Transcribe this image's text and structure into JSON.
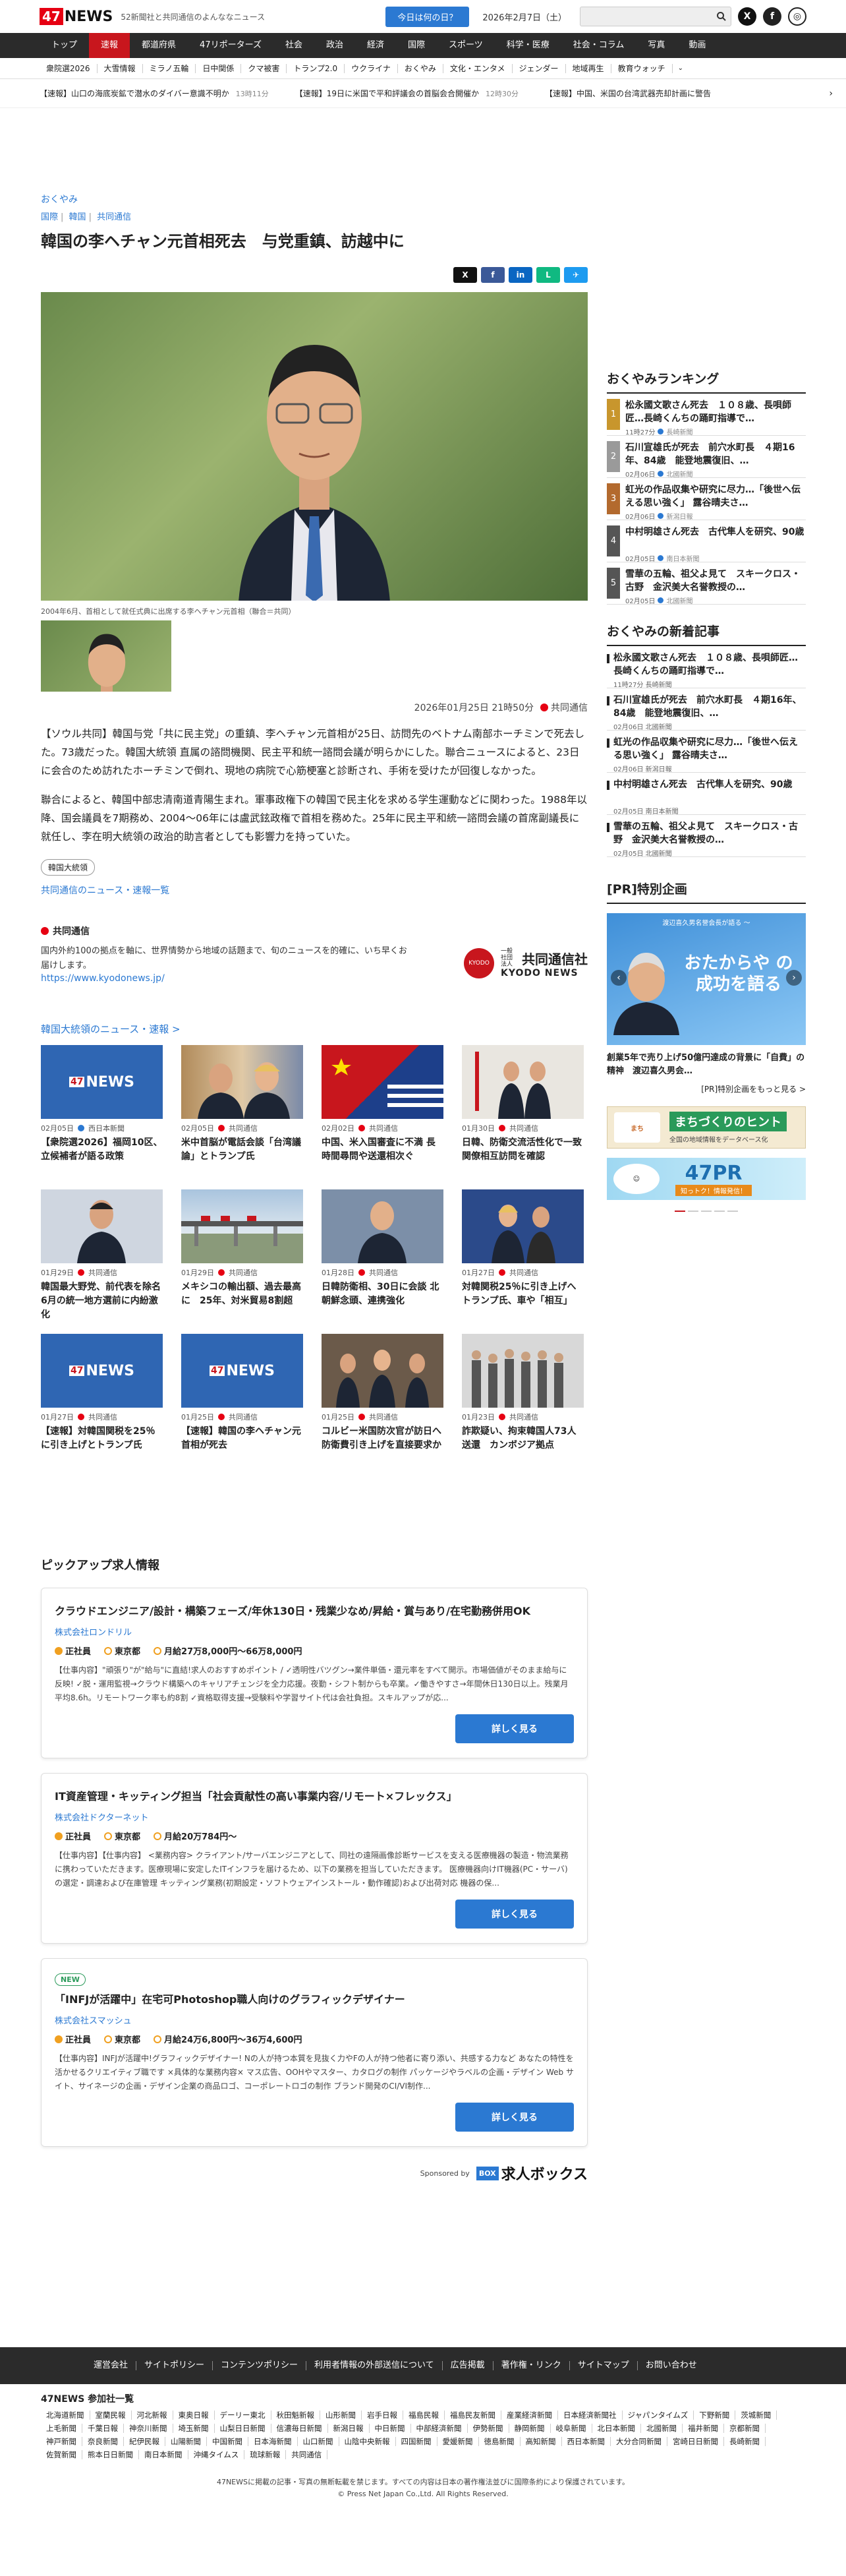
{
  "header": {
    "logo_text": "NEWS",
    "logo_num": "47",
    "tagline": "52新聞社と共同通信のよんななニュース",
    "today_button": "今日は何の日？",
    "date": "2026年2月7日（土）"
  },
  "nav": [
    "トップ",
    "速報",
    "都道府県",
    "47リポーターズ",
    "社会",
    "政治",
    "経済",
    "国際",
    "スポーツ",
    "科学・医療",
    "社会・コラム",
    "写真",
    "動画"
  ],
  "subnav": [
    "衆院選2026",
    "大雪情報",
    "ミラノ五輪",
    "日中関係",
    "クマ被害",
    "トランプ2.0",
    "ウクライナ",
    "おくやみ",
    "文化・エンタメ",
    "ジェンダー",
    "地域再生",
    "教育ウォッチ"
  ],
  "ticker": [
    {
      "text": "【速報】山口の海底炭鉱で潜水のダイバー意識不明か",
      "time": "13時11分"
    },
    {
      "text": "【速報】19日に米国で平和評議会の首脳会合開催か",
      "time": "12時30分"
    },
    {
      "text": "【速報】中国、米国の台湾武器売却計画に警告"
    }
  ],
  "article": {
    "kicker": "おくやみ",
    "breadcrumb": [
      "国際",
      "韓国",
      "共同通信"
    ],
    "title": "韓国の李ヘチャン元首相死去　与党重鎮、訪越中に",
    "caption": "2004年6月、首相として就任式典に出席する李ヘチャン元首相（聯合＝共同）",
    "datetime": "2026年01月25日 21時50分",
    "source": "共同通信",
    "paragraphs": [
      "【ソウル共同】韓国与党「共に民主党」の重鎮、李ヘチャン元首相が25日、訪問先のベトナム南部ホーチミンで死去した。73歳だった。韓国大統領 直属の諮問機関、民主平和統一諮問会議が明らかにした。聯合ニュースによると、23日に会合のため訪れたホーチミンで倒れ、現地の病院で心筋梗塞と診断され、手術を受けたが回復しなかった。",
      "聯合によると、韓国中部忠清南道青陽生まれ。軍事政権下の韓国で民主化を求める学生運動などに関わった。1988年以降、国会議員を7期務め、2004～06年には盧武鉉政権で首相を務めた。25年に民主平和統一諮問会議の首席副議長に就任し、李在明大統領の政治的助言者としても影響力を持っていた。"
    ],
    "tag": "韓国大統領",
    "more_link": "共同通信のニュース・速報一覧"
  },
  "kyodo": {
    "title": "共同通信",
    "desc": "国内外約100の拠点を軸に、世界情勢から地域の話題まで、旬のニュースを的確に、いち早くお届けします。",
    "url": "https://www.kyodonews.jp/",
    "logo_jp": "共同通信社",
    "logo_en": "KYODO NEWS",
    "logo_small": "一般社団法人"
  },
  "related": {
    "heading": "韓国大統領のニュース・速報 >",
    "items": [
      {
        "date": "02月05日",
        "src": "西日本新聞",
        "title": "【衆院選2026】福岡10区、立候補者が語る政策",
        "img": "news47"
      },
      {
        "date": "02月05日",
        "src": "共同通信",
        "title": "米中首脳が電話会談「台湾議論」とトランプ氏",
        "img": "people"
      },
      {
        "date": "02月02日",
        "src": "共同通信",
        "title": "中国、米入国審査に不満 長時間尋問や送還相次ぐ",
        "img": "flags"
      },
      {
        "date": "01月30日",
        "src": "共同通信",
        "title": "日韓、防衛交流活性化で一致　関僚相互訪問を確認",
        "img": "meeting"
      },
      {
        "date": "01月29日",
        "src": "共同通信",
        "title": "韓国最大野党、前代表を除名　6月の統一地方選前に内紛激化",
        "img": "person"
      },
      {
        "date": "01月29日",
        "src": "共同通信",
        "title": "メキシコの輸出額、過去最高に　25年、対米貿易8割超",
        "img": "bridge"
      },
      {
        "date": "01月28日",
        "src": "共同通信",
        "title": "日韓防衛相、30日に会談 北朝鮮念頭、連携強化",
        "img": "person2"
      },
      {
        "date": "01月27日",
        "src": "共同通信",
        "title": "対韓関税25％に引き上げへ　トランプ氏、車や「相互」",
        "img": "stage"
      },
      {
        "date": "01月27日",
        "src": "共同通信",
        "title": "【速報】対韓国関税を25％に引き上げとトランプ氏",
        "img": "news47"
      },
      {
        "date": "01月25日",
        "src": "共同通信",
        "title": "【速報】韓国の李ヘチャン元首相が死去",
        "img": "news47"
      },
      {
        "date": "01月25日",
        "src": "共同通信",
        "title": "コルビー米国防次官が訪日へ　防衛費引き上げを直接要求か",
        "img": "people2"
      },
      {
        "date": "01月23日",
        "src": "共同通信",
        "title": "詐欺疑い、拘束韓国人73人送還　カンボジア拠点",
        "img": "crowd"
      }
    ]
  },
  "jobs": {
    "heading": "ピックアップ求人情報",
    "items": [
      {
        "new": "",
        "title": "クラウドエンジニア/設計・構築フェーズ/年休130日・残業少なめ/昇給・賞与あり/在宅勤務併用OK",
        "company": "株式会社ロンドリル",
        "type": "正社員",
        "place": "東京都",
        "salary": "月給27万8,000円〜66万8,000円",
        "desc": "【仕事内容】\"頑張り\"が\"給与\"に直結!求人のおすすめポイント / ✓透明性バツグン→業件単価・還元率をすべて開示。市場価値がそのまま給与に反映! ✓脱・運用監視→クラウド構築へのキャリアチェンジを全力応援。夜勤・シフト制からも卒業。✓働きやすさ→年間休日130日以上。残業月平均8.6h。リモートワーク率も約8割 ✓資格取得支援→受験料や学習サイト代は会社負担。スキルアップが応...",
        "button": "詳しく見る"
      },
      {
        "new": "",
        "title": "IT資産管理・キッティング担当「社会貢献性の高い事業内容/リモート×フレックス」",
        "company": "株式会社ドクターネット",
        "type": "正社員",
        "place": "東京都",
        "salary": "月給20万784円〜",
        "desc": "【仕事内容】【仕事内容】 <業務内容> クライアント/サーバエンジニアとして、同社の遠隔画像診断サービスを支える医療機器の製造・物流業務に携わっていただきます。医療現場に安定したITインフラを届けるため、以下の業務を担当していただきます。 医療機器向けIT機器(PC・サーバ)の選定・調達および在庫管理 キッティング業務(初期設定・ソフトウェアインストール・動作確認)および出荷対応 機器の保...",
        "button": "詳しく見る"
      },
      {
        "new": "NEW",
        "title": "「INFJが活躍中」在宅可Photoshop職人向けのグラフィックデザイナー",
        "company": "株式会社スマッシュ",
        "type": "正社員",
        "place": "東京都",
        "salary": "月給24万6,800円〜36万4,600円",
        "desc": "【仕事内容】INFJが活躍中!グラフィックデザイナー! Nの人が持つ本質を見抜く力やFの人が持つ他者に寄り添い、共感する力など あなたの特性を活かせるクリエイティブ職です ×具体的な業務内容× マス広告、OOHやマスター、カタログの制作 パッケージやラベルの企画・デザイン Web サイト、サイネージの企画・デザイン企業の商品ロゴ、コーポレートロゴの制作 ブランド開発のCI/VI制作...",
        "button": "詳しく見る"
      }
    ],
    "sponsored_by": "Sponsored by",
    "sponsor_name": "求人ボックス"
  },
  "sidebar": {
    "ranking_title": "おくやみランキング",
    "ranking": [
      {
        "n": "1",
        "title": "松永國文歌さん死去　１０８歳、長唄師匠…長崎くんちの踊町指導で…",
        "date": "11時27分",
        "src": "長崎新聞"
      },
      {
        "n": "2",
        "title": "石川宣雄氏が死去　前穴水町長　４期16年、84歳　能登地震復旧、…",
        "date": "02月06日",
        "src": "北國新聞"
      },
      {
        "n": "3",
        "title": "虹光の作品収集や研究に尽力…「後世へ伝える思い強く」 露谷晴夫さ…",
        "date": "02月06日",
        "src": "新潟日報"
      },
      {
        "n": "4",
        "title": "中村明雄さん死去　古代隼人を研究、90歳",
        "date": "02月05日",
        "src": "南日本新聞"
      },
      {
        "n": "5",
        "title": "雪華の五輪、祖父よ見て　スキークロス・古野　金沢美大名誉教授の…",
        "date": "02月05日",
        "src": "北國新聞"
      }
    ],
    "new_title": "おくやみの新着記事",
    "new": [
      {
        "title": "松永國文歌さん死去　１０８歳、長唄師匠…長崎くんちの踊町指導で…",
        "date": "11時27分",
        "src": "長崎新聞"
      },
      {
        "title": "石川宣雄氏が死去　前穴水町長　４期16年、84歳　能登地震復旧、…",
        "date": "02月06日",
        "src": "北國新聞"
      },
      {
        "title": "虹光の作品収集や研究に尽力…「後世へ伝える思い強く」 露谷晴夫さ…",
        "date": "02月06日",
        "src": "新潟日報"
      },
      {
        "title": "中村明雄さん死去　古代隼人を研究、90歳",
        "date": "02月05日",
        "src": "南日本新聞"
      },
      {
        "title": "雪華の五輪、祖父よ見て　スキークロス・古野　金沢美大名誉教授の…",
        "date": "02月05日",
        "src": "北國新聞"
      }
    ],
    "pr_title": "[PR]特別企画",
    "promo_head": "渡辺喜久男名誉会長が語る 〜",
    "promo_text": "おたからや の成功を語る",
    "pr_caption": "創業5年で売り上げ50億円達成の背景に「自費」の精神　渡辺喜久男会…",
    "pr_more": "[PR]特別企画をもっと見る >",
    "banner1": "まちづくりのヒント",
    "banner1_sub": "全国の地域情報をデータベース化",
    "banner2": "47PR",
    "banner2_sub": "知っトク！情報発信！"
  },
  "footer": {
    "links": [
      "運営会社",
      "サイトポリシー",
      "コンテンツポリシー",
      "利用者情報の外部送信について",
      "広告掲載",
      "著作権・リンク",
      "サイトマップ",
      "お問い合わせ"
    ],
    "partners_title": "47NEWS 参加社一覧",
    "partners": [
      "北海道新聞",
      "室蘭民報",
      "河北新報",
      "東奥日報",
      "デーリー東北",
      "秋田魁新報",
      "山形新聞",
      "岩手日報",
      "福島民報",
      "福島民友新聞",
      "産業経済新聞",
      "日本経済新聞社",
      "ジャパンタイムズ",
      "下野新聞",
      "茨城新聞",
      "上毛新聞",
      "千葉日報",
      "神奈川新聞",
      "埼玉新聞",
      "山梨日日新聞",
      "信濃毎日新聞",
      "新潟日報",
      "中日新聞",
      "中部経済新聞",
      "伊勢新聞",
      "静岡新聞",
      "岐阜新聞",
      "北日本新聞",
      "北國新聞",
      "福井新聞",
      "京都新聞",
      "神戸新聞",
      "奈良新聞",
      "紀伊民報",
      "山陽新聞",
      "中国新聞",
      "日本海新聞",
      "山口新聞",
      "山陰中央新報",
      "四国新聞",
      "愛媛新聞",
      "徳島新聞",
      "高知新聞",
      "西日本新聞",
      "大分合同新聞",
      "宮崎日日新聞",
      "長崎新聞",
      "佐賀新聞",
      "熊本日日新聞",
      "南日本新聞",
      "沖縄タイムス",
      "琉球新報",
      "共同通信"
    ],
    "copy1": "47NEWSに掲載の記事・写真の無断転載を禁じます。すべての内容は日本の著作権法並びに国際条約により保護されています。",
    "copy2": "© Press Net Japan Co.,Ltd. All Rights Reserved."
  },
  "colors": {
    "accent": "#c8161d",
    "link": "#2b79d2",
    "nav_bg": "#2b2b2b"
  }
}
